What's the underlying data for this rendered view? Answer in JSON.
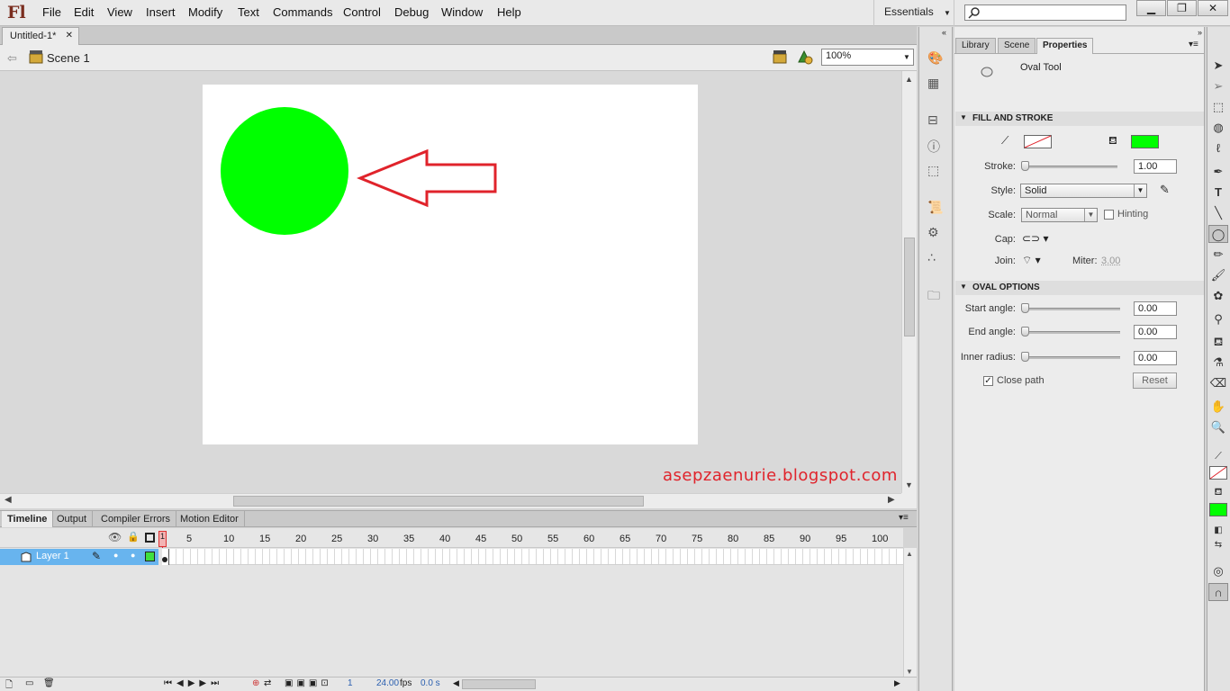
{
  "app": {
    "logo": "Fl",
    "menu": [
      "File",
      "Edit",
      "View",
      "Insert",
      "Modify",
      "Text",
      "Commands",
      "Control",
      "Debug",
      "Window",
      "Help"
    ],
    "workspace": "Essentials",
    "search_placeholder": ""
  },
  "document": {
    "tab_title": "Untitled-1*",
    "scene": "Scene 1",
    "zoom": "100%"
  },
  "stage": {
    "watermark": "asepzaenurie.blogspot.com",
    "circle_color": "#00ff00",
    "arrow_color": "#e0232b"
  },
  "timeline": {
    "tabs": [
      "Timeline",
      "Output",
      "Compiler Errors",
      "Motion Editor"
    ],
    "frame_numbers": [
      "1",
      "5",
      "10",
      "15",
      "20",
      "25",
      "30",
      "35",
      "40",
      "45",
      "50",
      "55",
      "60",
      "65",
      "70",
      "75",
      "80",
      "85",
      "90",
      "95",
      "100"
    ],
    "layer_name": "Layer 1",
    "current_frame": "1",
    "fps": "24.00",
    "fps_unit": "fps",
    "time": "0.0 s"
  },
  "properties": {
    "tabs": [
      "Library",
      "Scene",
      "Properties"
    ],
    "tool_name": "Oval Tool",
    "fill_and_stroke": {
      "heading": "FILL AND STROKE",
      "fill_color": "#00ff00",
      "stroke_label": "Stroke:",
      "stroke_value": "1.00",
      "style_label": "Style:",
      "style_value": "Solid",
      "scale_label": "Scale:",
      "scale_value": "Normal",
      "hinting_label": "Hinting",
      "cap_label": "Cap:",
      "join_label": "Join:",
      "miter_label": "Miter:",
      "miter_value": "3.00"
    },
    "oval_options": {
      "heading": "OVAL OPTIONS",
      "start_label": "Start angle:",
      "start_value": "0.00",
      "end_label": "End angle:",
      "end_value": "0.00",
      "inner_label": "Inner radius:",
      "inner_value": "0.00",
      "close_path_label": "Close path",
      "close_path_checked": true,
      "reset_label": "Reset"
    }
  }
}
